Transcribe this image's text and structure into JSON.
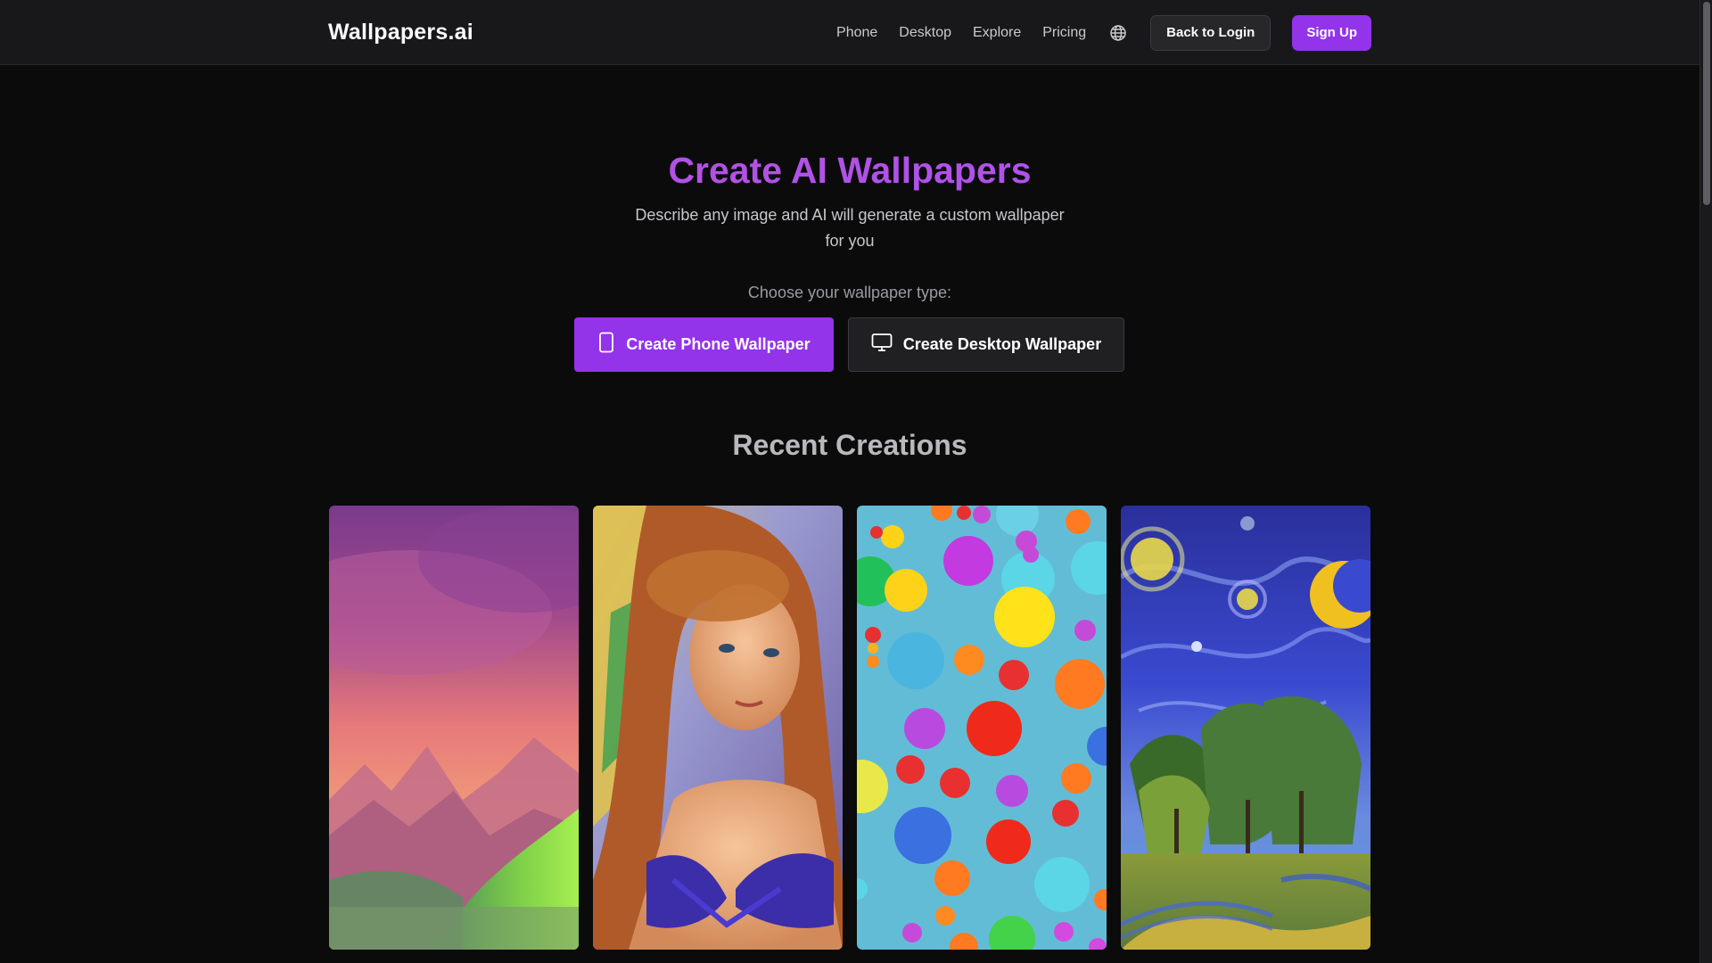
{
  "header": {
    "logo": "Wallpapers.ai",
    "nav": [
      "Phone",
      "Desktop",
      "Explore",
      "Pricing"
    ],
    "globe_icon": "globe-icon",
    "login_label": "Back to Login",
    "signup_label": "Sign Up"
  },
  "hero": {
    "title": "Create AI Wallpapers",
    "subtitle": "Describe any image and AI will generate a custom wallpaper for you",
    "choose_label": "Choose your wallpaper type:",
    "phone_button": "Create Phone Wallpaper",
    "phone_icon": "phone-icon",
    "desktop_button": "Create Desktop Wallpaper",
    "desktop_icon": "monitor-icon"
  },
  "recent": {
    "heading": "Recent Creations"
  },
  "colors": {
    "accent": "#9333ea",
    "background": "#0b0b0c",
    "header": "#18181b"
  }
}
